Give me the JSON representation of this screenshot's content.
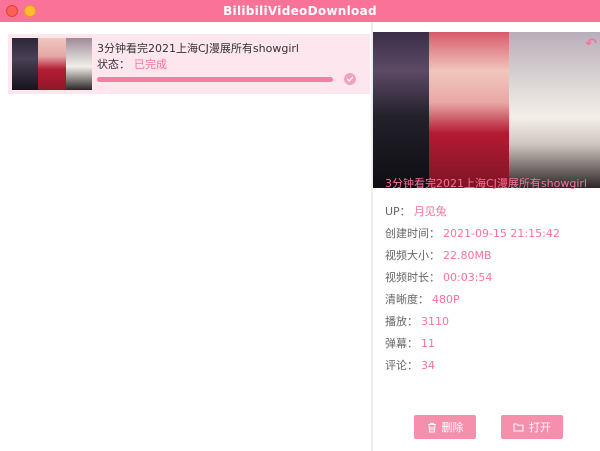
{
  "window": {
    "title": "BilibiliVideoDownload"
  },
  "list": {
    "items": [
      {
        "title": "3分钟看完2021上海CJ漫展所有showgirl",
        "status_label": "状态：",
        "status_value": "已完成",
        "progress": 100
      }
    ]
  },
  "detail": {
    "title": "3分钟看完2021上海CJ漫展所有showgirl",
    "rows": [
      {
        "label": "UP：",
        "value": "月见兔"
      },
      {
        "label": "创建时间：",
        "value": "2021-09-15 21:15:42"
      },
      {
        "label": "视频大小：",
        "value": "22.80MB"
      },
      {
        "label": "视频时长：",
        "value": "00:03:54"
      },
      {
        "label": "清晰度：",
        "value": "480P"
      },
      {
        "label": "播放：",
        "value": "3110"
      },
      {
        "label": "弹幕：",
        "value": "11"
      },
      {
        "label": "评论：",
        "value": "34"
      }
    ],
    "delete_label": "删除",
    "open_label": "打开"
  },
  "colors": {
    "accent": "#fb7299",
    "item_bg": "#fde6ee",
    "button": "#f68fac"
  },
  "icons": {
    "close": "close-icon",
    "minimize": "minimize-icon",
    "check": "check-icon",
    "back": "back-arrow-icon",
    "trash": "trash-icon",
    "folder": "folder-icon"
  }
}
